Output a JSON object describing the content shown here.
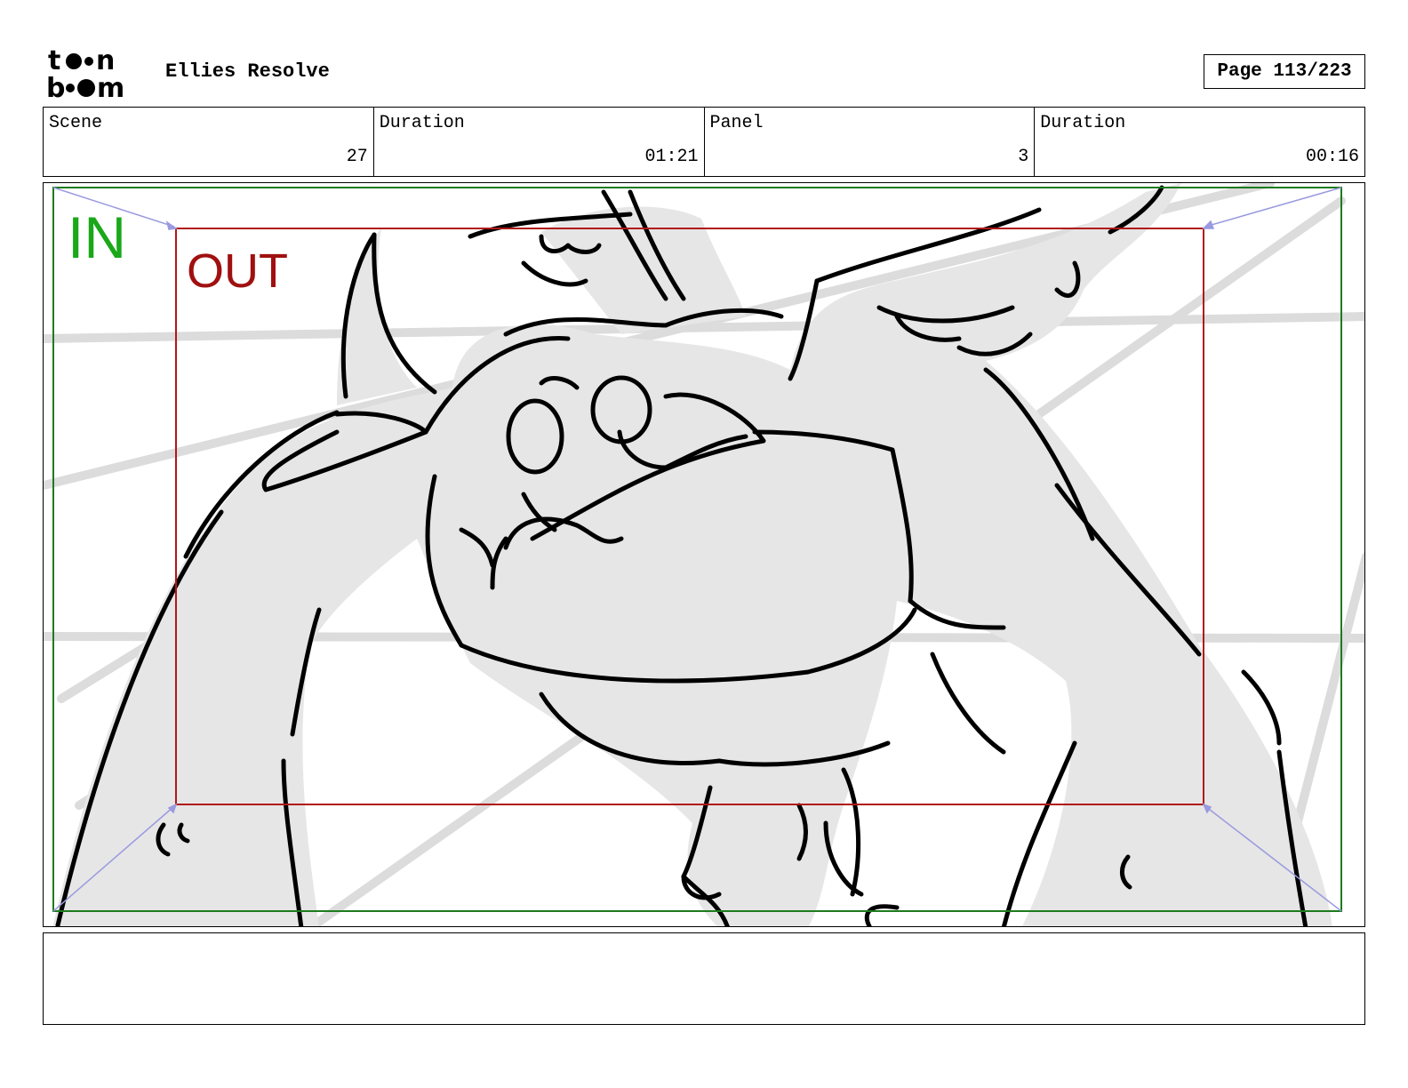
{
  "header": {
    "logo_text": "toonboom",
    "project_title": "Ellies Resolve",
    "page_label": "Page 113/223"
  },
  "info": {
    "scene_label": "Scene",
    "scene_value": "27",
    "scene_duration_label": "Duration",
    "scene_duration_value": "01:21",
    "panel_label": "Panel",
    "panel_value": "3",
    "panel_duration_label": "Duration",
    "panel_duration_value": "00:16"
  },
  "frame": {
    "in_label": "IN",
    "out_label": "OUT",
    "in_color": "#1aa81a",
    "out_color": "#a01010"
  },
  "caption": {
    "text": ""
  }
}
